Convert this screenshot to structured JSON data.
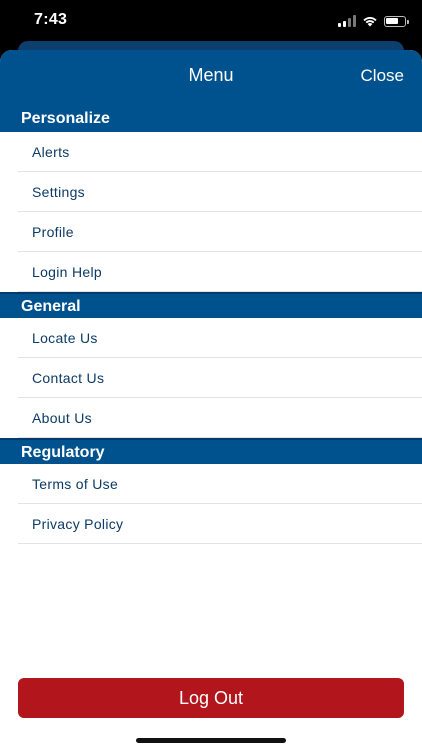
{
  "status_bar": {
    "time": "7:43"
  },
  "header": {
    "title": "Menu",
    "close_label": "Close"
  },
  "sections": [
    {
      "title": "Personalize",
      "items": [
        "Alerts",
        "Settings",
        "Profile",
        "Login Help"
      ]
    },
    {
      "title": "General",
      "items": [
        "Locate Us",
        "Contact Us",
        "About Us"
      ]
    },
    {
      "title": "Regulatory",
      "items": [
        "Terms of Use",
        "Privacy Policy"
      ]
    }
  ],
  "logout_label": "Log Out",
  "colors": {
    "header_blue": "#00528f",
    "item_text": "#0d3a66",
    "logout_red": "#b3151c"
  }
}
